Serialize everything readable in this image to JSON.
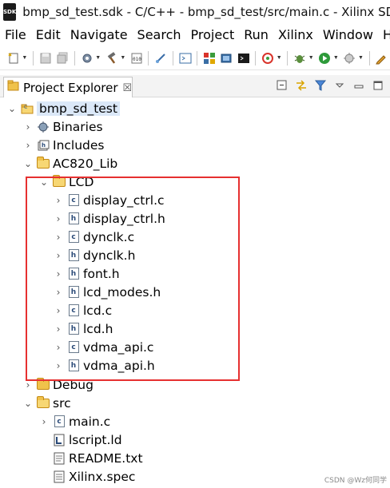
{
  "window": {
    "app_icon_text": "SDK",
    "title": "bmp_sd_test.sdk - C/C++ - bmp_sd_test/src/main.c - Xilinx SDK"
  },
  "menu": [
    "File",
    "Edit",
    "Navigate",
    "Search",
    "Project",
    "Run",
    "Xilinx",
    "Window",
    "Help"
  ],
  "view": {
    "tab_label": "Project Explorer",
    "tab_close": "☒"
  },
  "tree": {
    "project": "bmp_sd_test",
    "binaries": "Binaries",
    "includes": "Includes",
    "ac820_lib": "AC820_Lib",
    "lcd": "LCD",
    "lcd_files": [
      "display_ctrl.c",
      "display_ctrl.h",
      "dynclk.c",
      "dynclk.h",
      "font.h",
      "lcd_modes.h",
      "lcd.c",
      "lcd.h",
      "vdma_api.c",
      "vdma_api.h"
    ],
    "debug": "Debug",
    "src": "src",
    "main_c": "main.c",
    "lscript": "lscript.ld",
    "readme": "README.txt",
    "xilinx_spec": "Xilinx.spec"
  },
  "watermark": "CSDN @Wz何同学",
  "colors": {
    "highlight_box": "#e63030",
    "selection": "#dbe8f8",
    "folder": "#f0c24b"
  }
}
